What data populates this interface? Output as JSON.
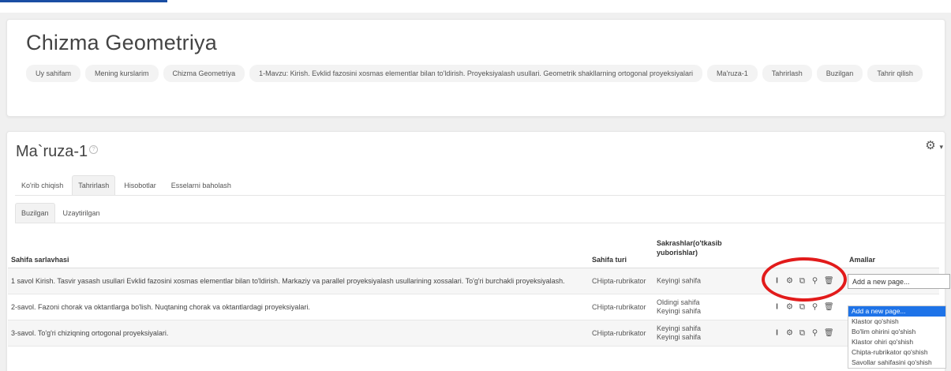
{
  "course": {
    "title": "Chizma Geometriya"
  },
  "breadcrumb": [
    "Uy sahifam",
    "Mening kurslarim",
    "Chizma Geometriya",
    "1-Mavzu: Kirish. Evklid fazosini xosmas elementlar bilan to'ldirish. Proyeksiyalash usullari. Geometrik shakllarning ortogonal proyeksiyalari",
    "Ma'ruza-1",
    "Tahrirlash",
    "Buzilgan",
    "Tahrir qilish"
  ],
  "lesson": {
    "title": "Ma`ruza-1",
    "help_icon": "question-circle-icon",
    "settings_icon": "gear-icon"
  },
  "tabs": [
    "Ko'rib chiqish",
    "Tahrirlash",
    "Hisobotlar",
    "Esselarni baholash"
  ],
  "subtabs": [
    "Buzilgan",
    "Uzaytirilgan"
  ],
  "table": {
    "headers": {
      "title": "Sahifa sarlavhasi",
      "type": "Sahifa turi",
      "jumps": "Sakrashlar(o'tkasib yuborishlar)",
      "actions": "Amallar"
    },
    "rows": [
      {
        "title": "1 savol Kirish. Tasvir yasash usullari Evklid fazosini xosmas elementlar bilan to'ldirish. Markaziy va parallel proyeksiyalash usullarining xossalari. To'g'ri burchakli proyeksiyalash.",
        "type": "CHipta-rubrikator",
        "jumps": [
          "Keyingi sahifa"
        ]
      },
      {
        "title": "2-savol. Fazoni chorak va oktantlarga bo'lish. Nuqtaning chorak va oktantlardagi proyeksiyalari.",
        "type": "CHipta-rubrikator",
        "jumps": [
          "Oldingi sahifa",
          "Keyingi sahifa"
        ]
      },
      {
        "title": "3-savol. To'g'ri chiziqning ortogonal proyeksiyalari.",
        "type": "CHipta-rubrikator",
        "jumps": [
          "Keyingi sahifa",
          "Keyingi sahifa"
        ]
      }
    ],
    "action_icons": [
      "text-cursor-icon",
      "gear-icon",
      "copy-icon",
      "zoom-icon",
      "trash-icon"
    ]
  },
  "add_page": {
    "value": "Add a new page...",
    "options": [
      "Add a new page...",
      "Klastor qo'shish",
      "Bo'lim ohirini qo'shish",
      "Klastor ohiri qo'shish",
      "Chipta-rubrikator qo'shish",
      "Savollar sahifasini qo'shish"
    ]
  },
  "colors": {
    "annotation": "#e21b1b",
    "selected": "#1e73e8"
  }
}
